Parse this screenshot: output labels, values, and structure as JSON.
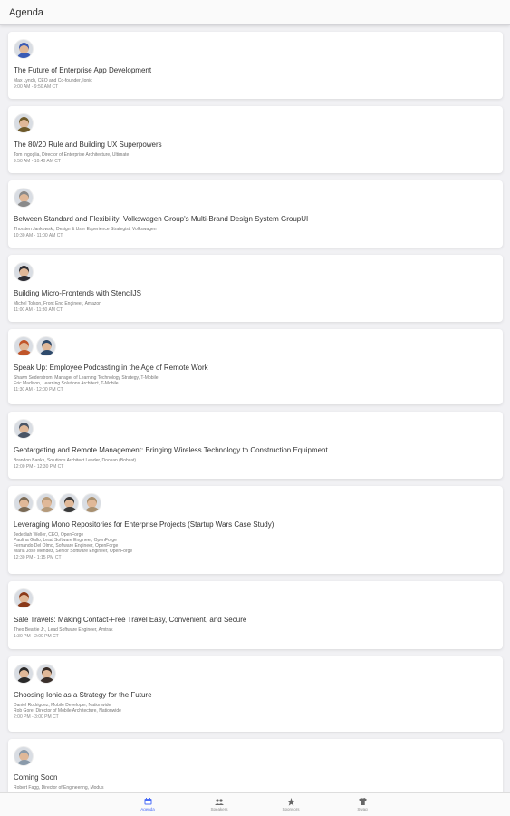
{
  "header": {
    "title": "Agenda"
  },
  "colors": {
    "accent": "#4a6cf7",
    "tab_inactive": "#666666"
  },
  "sessions": [
    {
      "title": "The Future of Enterprise App Development",
      "speakers": [
        "Max Lynch, CEO and Co-founder, Ionic"
      ],
      "time": "9:00 AM - 9:50 AM CT",
      "avatars": [
        "#3a5bb5"
      ]
    },
    {
      "title": "The 80/20 Rule and Building UX Superpowers",
      "speakers": [
        "Tom Ingoglia, Director of Enterprise Architecture, Ultimate"
      ],
      "time": "9:50 AM - 10:40 AM CT",
      "avatars": [
        "#6e5a2a"
      ]
    },
    {
      "title": "Between Standard and Flexibility: Volkswagen Group's Multi-Brand Design System GroupUI",
      "speakers": [
        "Thorsten Jankowski, Design & User Experience Strategist, Volkswagen"
      ],
      "time": "10:30 AM - 11:00 AM CT",
      "avatars": [
        "#8a8a8a"
      ]
    },
    {
      "title": "Building Micro-Frontends with StencilJS",
      "speakers": [
        "Michel Tolson, Front End Engineer, Amazon"
      ],
      "time": "11:00 AM - 11:30 AM CT",
      "avatars": [
        "#2d2d33"
      ]
    },
    {
      "title": "Speak Up: Employee Podcasting in the Age of Remote Work",
      "speakers": [
        "Shawn Sederstrom, Manager of Learning Technology Strategy, T-Mobile",
        "Eric Madison, Learning Solutions Architect, T-Mobile"
      ],
      "time": "11:30 AM - 12:00 PM CT",
      "avatars": [
        "#c0552a",
        "#2e4a6b"
      ]
    },
    {
      "title": "Geotargeting and Remote Management: Bringing Wireless Technology to Construction Equipment",
      "speakers": [
        "Brandon Banks, Solutions Architect Leader, Doosan (Bobcat)"
      ],
      "time": "12:00 PM - 12:30 PM CT",
      "avatars": [
        "#4a5566"
      ]
    },
    {
      "title": "Leveraging Mono Repositories for Enterprise Projects (Startup Wars Case Study)",
      "speakers": [
        "Jedediah Weller, CEO, OpenForge",
        "Paulina Gallo, Lead Software Engineer, OpenForge",
        "Fernando Del Olmo, Software Engineer, OpenForge",
        "Maria José Méndez, Senior Software Engineer, OpenForge"
      ],
      "time": "12:30 PM - 1:15 PM CT",
      "avatars": [
        "#7a6a55",
        "#b59a7a",
        "#3a3a3a",
        "#a89070"
      ]
    },
    {
      "title": "Safe Travels: Making Contact-Free Travel Easy, Convenient, and Secure",
      "speakers": [
        "Theo Beattie Jr., Lead Software Engineer, Amtrak"
      ],
      "time": "1:30 PM - 2:00 PM CT",
      "avatars": [
        "#8a3a1a"
      ]
    },
    {
      "title": "Choosing Ionic as a Strategy for the Future",
      "speakers": [
        "Daniel Rodriguez, Mobile Developer, Nationwide",
        "Rob Gore, Director of Mobile Architecture, Nationwide"
      ],
      "time": "2:00 PM - 3:00 PM CT",
      "avatars": [
        "#2a2a2a",
        "#3a2f2a"
      ]
    },
    {
      "title": "Coming Soon",
      "speakers": [
        "Robert Fagg, Director of Engineering, Modus"
      ],
      "time": "",
      "avatars": [
        "#8a9aaa"
      ]
    }
  ],
  "tabs": [
    {
      "label": "Agenda",
      "icon": "calendar-icon",
      "active": true
    },
    {
      "label": "Speakers",
      "icon": "people-icon",
      "active": false
    },
    {
      "label": "Sponsors",
      "icon": "star-icon",
      "active": false
    },
    {
      "label": "Swag",
      "icon": "shirt-icon",
      "active": false
    }
  ]
}
